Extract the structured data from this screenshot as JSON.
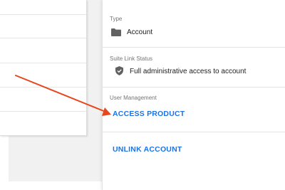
{
  "details": {
    "type": {
      "label": "Type",
      "value": "Account",
      "icon": "folder-icon"
    },
    "suite_link_status": {
      "label": "Suite Link Status",
      "value": "Full administrative access to account",
      "icon": "shield-icon"
    },
    "user_management": {
      "label": "User Management",
      "action": "ACCESS PRODUCT"
    },
    "unlink": {
      "action": "UNLINK ACCOUNT"
    }
  },
  "colors": {
    "link": "#1a73e8",
    "annotation_arrow": "#e8461c",
    "label": "#757575",
    "text": "#212121"
  }
}
